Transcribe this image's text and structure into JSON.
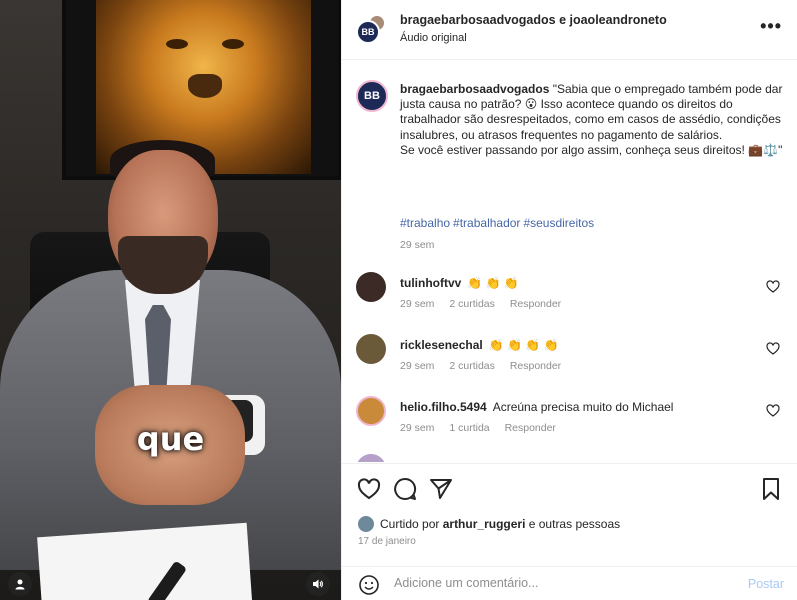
{
  "video": {
    "caption": "que",
    "user_icon": "person-icon",
    "sound_icon": "speaker-icon"
  },
  "header": {
    "usernames": "bragaebarbosaadvogados e joaoleandroneto",
    "subtitle": "Áudio original",
    "more": "•••"
  },
  "post": {
    "avatar_initials": "BB",
    "username": "bragaebarbosaadvogados",
    "text": "\"Sabia que o empregado também pode dar justa causa no patrão? 😮 Isso acontece quando os direitos do trabalhador são desrespeitados, como em casos de assédio, condições insalubres, ou atrasos frequentes no pagamento de salários.",
    "text2": "Se você estiver passando por algo assim, conheça seus direitos! 💼⚖️\"",
    "tags": [
      "#trabalho",
      "#trabalhador",
      "#seusdireitos"
    ],
    "time": "29 sem"
  },
  "comments": [
    {
      "username": "tulinhoftvv",
      "text": "👏 👏 👏",
      "time": "29 sem",
      "likes": "2 curtidas",
      "reply": "Responder",
      "avatar_color": "#3b2a26"
    },
    {
      "username": "ricklesenechal",
      "text": "👏 👏 👏 👏",
      "time": "29 sem",
      "likes": "2 curtidas",
      "reply": "Responder",
      "avatar_color": "#6b5a3a"
    },
    {
      "username": "helio.filho.5494",
      "text": "Acreúna precisa muito do Michael",
      "time": "29 sem",
      "likes": "1 curtida",
      "reply": "Responder",
      "avatar_color": "#c98a3a"
    }
  ],
  "actions": {
    "liked_prefix": "Curtido por",
    "liked_user": "arthur_ruggeri",
    "liked_suffix": "e outras pessoas",
    "date": "17 de janeiro"
  },
  "composer": {
    "placeholder": "Adicione um comentário...",
    "post_label": "Postar"
  },
  "colors": {
    "link": "#4767a8",
    "muted": "#8e8e8e",
    "post_button": "#a8c9f5",
    "brand_avatar": "#1d2a57"
  }
}
